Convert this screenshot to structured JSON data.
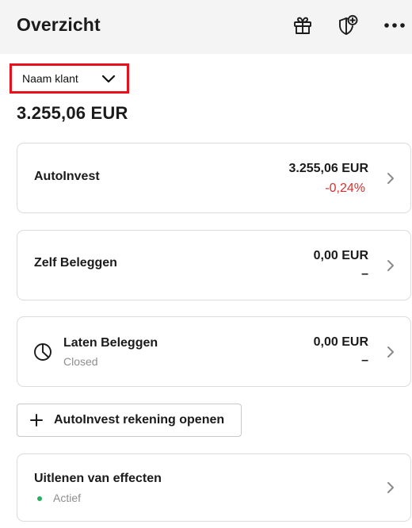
{
  "header": {
    "title": "Overzicht",
    "icons": [
      "gift-icon",
      "shield-plus-icon",
      "more-icon"
    ]
  },
  "account_selector": {
    "label": "Naam klant",
    "icon": "chevron-down-icon"
  },
  "total_value": "3.255,06 EUR",
  "cards": [
    {
      "title": "AutoInvest",
      "amount": "3.255,06 EUR",
      "change": "-0,24%",
      "change_color": "#d93030"
    },
    {
      "title": "Zelf Beleggen",
      "amount": "0,00 EUR",
      "change": "–"
    },
    {
      "title": "Laten Beleggen",
      "status": "Closed",
      "amount": "0,00 EUR",
      "change": "–",
      "icon": "clock-icon"
    }
  ],
  "open_account_button": {
    "label": "AutoInvest rekening openen",
    "icon": "plus-icon"
  },
  "lending_card": {
    "title": "Uitlenen van effecten",
    "status": "Actief",
    "status_color": "#27ae60"
  },
  "colors": {
    "accent_red": "#e8101a",
    "negative": "#d93030",
    "active_green": "#27ae60",
    "header_bg": "#f4f4f5"
  }
}
